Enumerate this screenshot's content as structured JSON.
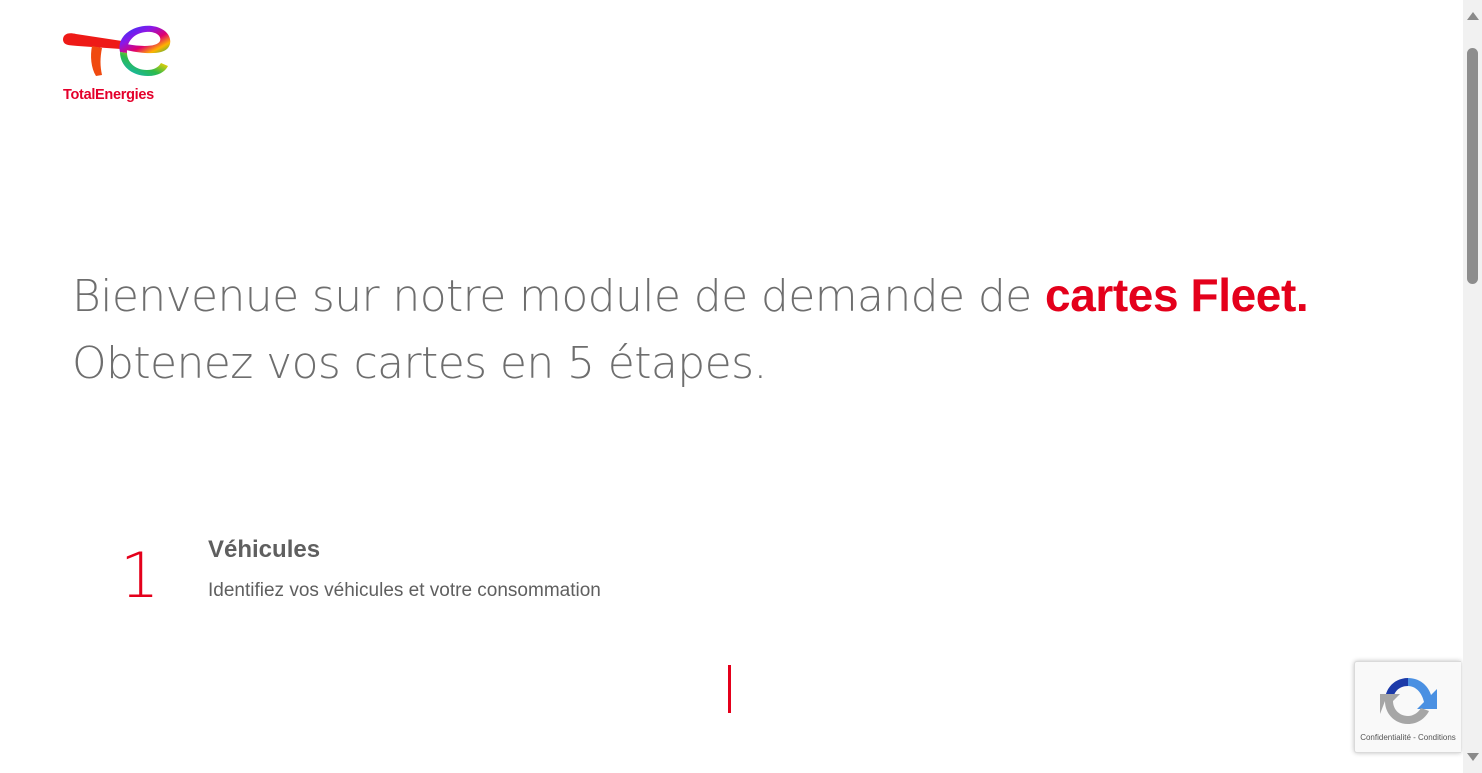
{
  "brand": {
    "logo_text": "TotalEnergies",
    "primary_color": "#e4001b"
  },
  "hero": {
    "text_before": "Bienvenue sur notre module de demande de ",
    "accent": "cartes Fleet.",
    "text_after": "  Obtenez vos cartes en 5 étapes."
  },
  "steps": [
    {
      "number": "1",
      "title": "Véhicules",
      "description": "Identifiez vos véhicules et votre consommation"
    }
  ],
  "recaptcha": {
    "privacy_label": "Confidentialité",
    "separator": " - ",
    "terms_label": "Conditions",
    "icon": "recaptcha-icon"
  }
}
